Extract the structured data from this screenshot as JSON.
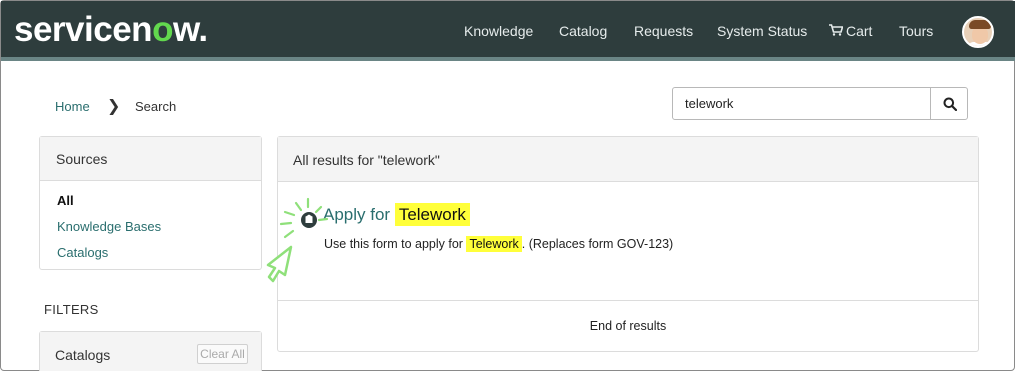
{
  "header": {
    "logo_text_a": "servicen",
    "logo_text_o": "o",
    "logo_text_b": "w.",
    "nav": [
      {
        "label": "Knowledge"
      },
      {
        "label": "Catalog"
      },
      {
        "label": "Requests"
      },
      {
        "label": "System Status"
      },
      {
        "label": "Cart",
        "icon": "cart-icon"
      },
      {
        "label": "Tours"
      }
    ]
  },
  "breadcrumb": {
    "home": "Home",
    "separator": "❯",
    "current": "Search"
  },
  "search": {
    "value": "telework",
    "button_icon": "magnifier-icon"
  },
  "sources": {
    "title": "Sources",
    "items": [
      {
        "label": "All",
        "active": true
      },
      {
        "label": "Knowledge Bases",
        "active": false
      },
      {
        "label": "Catalogs",
        "active": false
      }
    ]
  },
  "filters": {
    "title": "FILTERS",
    "catalogs_title": "Catalogs",
    "clear_all": "Clear All"
  },
  "results": {
    "header": "All results for \"telework\"",
    "items": [
      {
        "title_prefix": "Apply for",
        "title_highlight": "Telework",
        "desc_prefix": "Use this form to apply for",
        "desc_highlight": "Telework",
        "desc_suffix": ". (Replaces form GOV-123)",
        "icon": "catalog-item-icon"
      }
    ],
    "footer": "End of results"
  },
  "colors": {
    "header_bg": "#2e3d3d",
    "link": "#2a6e6e",
    "highlight": "#ffff3a",
    "logo_accent": "#62d84e"
  }
}
